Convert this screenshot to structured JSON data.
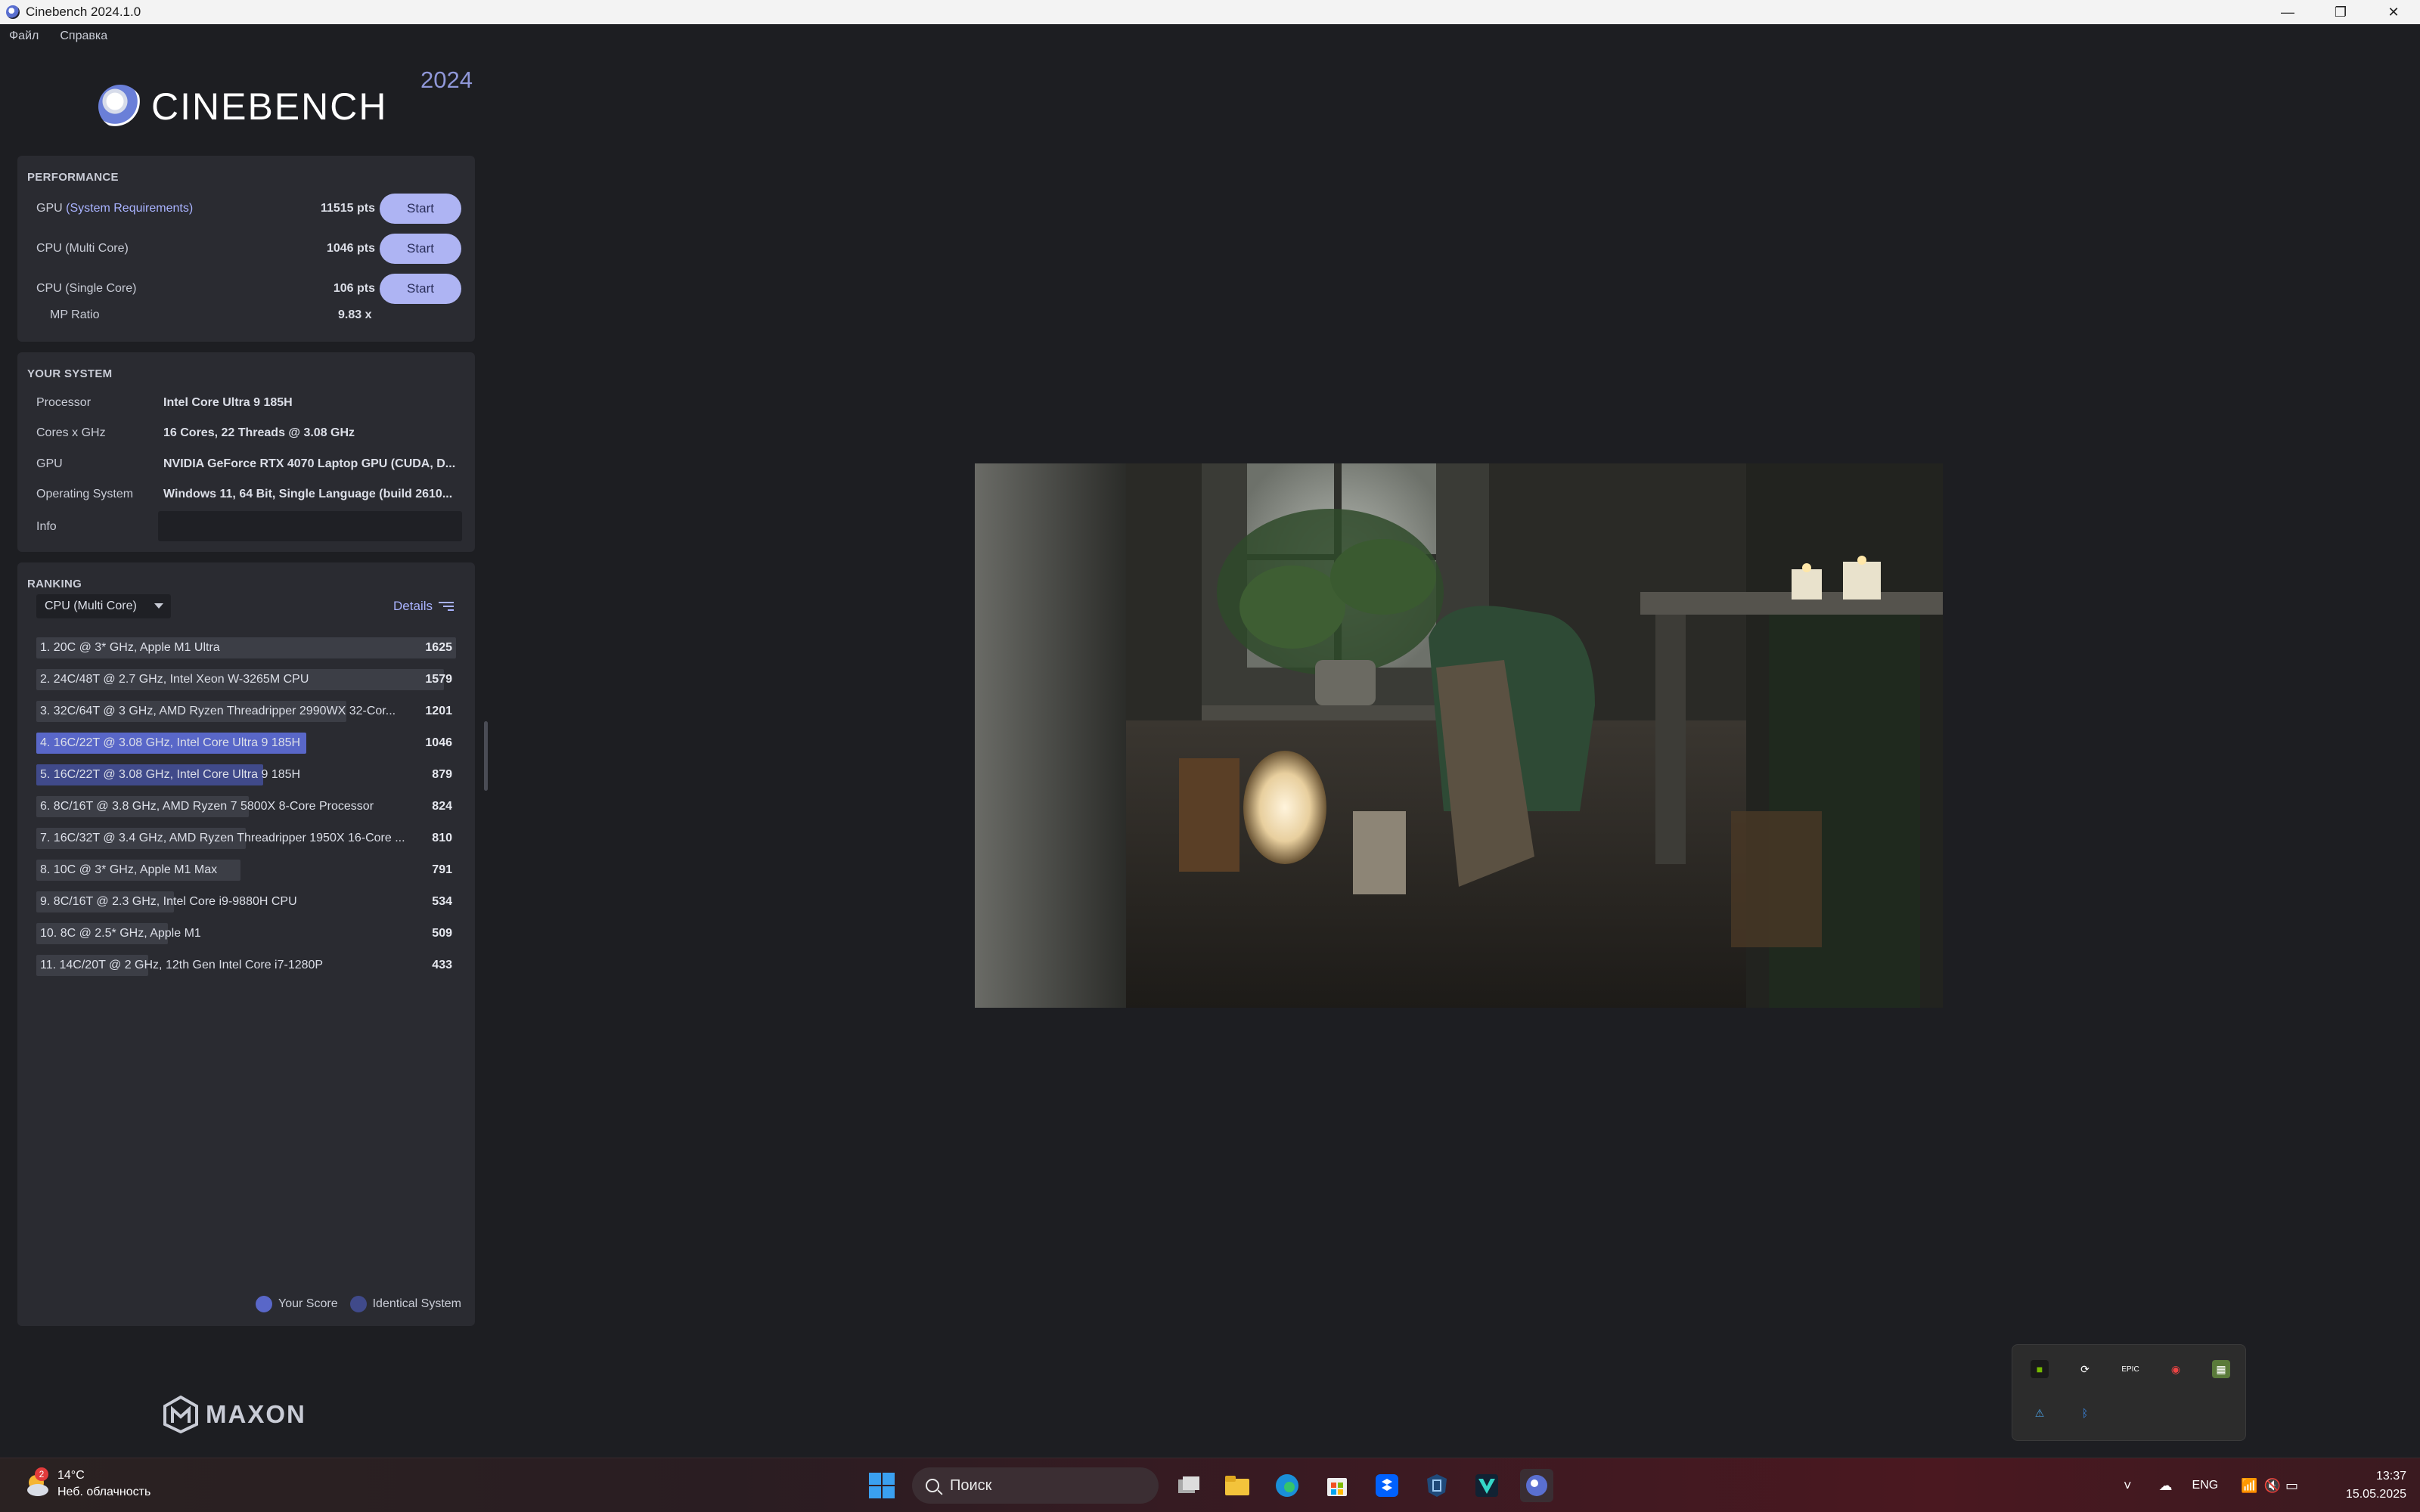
{
  "window": {
    "title": "Cinebench 2024.1.0",
    "minimize": "—",
    "restore": "❐",
    "close": "✕"
  },
  "menu": [
    "Файл",
    "Справка"
  ],
  "logo": {
    "word": "CINEBENCH",
    "year": "2024"
  },
  "performance": {
    "title": "PERFORMANCE",
    "rows": [
      {
        "label": "GPU ",
        "link": "(System Requirements)",
        "pts": "11515 pts",
        "button": "Start"
      },
      {
        "label": "CPU (Multi Core)",
        "link": "",
        "pts": "1046 pts",
        "button": "Start"
      },
      {
        "label": "CPU (Single Core)",
        "link": "",
        "pts": "106 pts",
        "button": "Start"
      }
    ],
    "mp_label": "MP Ratio",
    "mp_value": "9.83 x"
  },
  "system": {
    "title": "YOUR SYSTEM",
    "rows": [
      {
        "k": "Processor",
        "v": "Intel Core Ultra 9 185H"
      },
      {
        "k": "Cores x GHz",
        "v": "16 Cores, 22 Threads @ 3.08 GHz"
      },
      {
        "k": "GPU",
        "v": "NVIDIA GeForce RTX 4070 Laptop GPU (CUDA, D..."
      },
      {
        "k": "Operating System",
        "v": "Windows 11, 64 Bit, Single Language (build 2610..."
      },
      {
        "k": "Info",
        "v": ""
      }
    ]
  },
  "ranking": {
    "title": "RANKING",
    "select": "CPU (Multi Core)",
    "details": "Details",
    "items": [
      {
        "name": "1. 20C @ 3* GHz, Apple M1 Ultra",
        "score": "1625",
        "value": 1625,
        "kind": "other"
      },
      {
        "name": "2. 24C/48T @ 2.7 GHz, Intel Xeon W-3265M CPU",
        "score": "1579",
        "value": 1579,
        "kind": "other"
      },
      {
        "name": "3. 32C/64T @ 3 GHz, AMD Ryzen Threadripper 2990WX 32-Cor...",
        "score": "1201",
        "value": 1201,
        "kind": "other"
      },
      {
        "name": "4. 16C/22T @ 3.08 GHz, Intel Core Ultra 9 185H",
        "score": "1046",
        "value": 1046,
        "kind": "mine"
      },
      {
        "name": "5. 16C/22T @ 3.08 GHz, Intel Core Ultra 9 185H",
        "score": "879",
        "value": 879,
        "kind": "ident"
      },
      {
        "name": "6. 8C/16T @ 3.8 GHz, AMD Ryzen 7 5800X 8-Core Processor",
        "score": "824",
        "value": 824,
        "kind": "other"
      },
      {
        "name": "7. 16C/32T @ 3.4 GHz, AMD Ryzen Threadripper 1950X 16-Core ...",
        "score": "810",
        "value": 810,
        "kind": "other"
      },
      {
        "name": "8. 10C @ 3* GHz, Apple M1 Max",
        "score": "791",
        "value": 791,
        "kind": "other"
      },
      {
        "name": "9. 8C/16T @ 2.3 GHz, Intel Core i9-9880H CPU",
        "score": "534",
        "value": 534,
        "kind": "other"
      },
      {
        "name": "10. 8C @ 2.5* GHz, Apple M1",
        "score": "509",
        "value": 509,
        "kind": "other"
      },
      {
        "name": "11. 14C/20T @ 2 GHz, 12th Gen Intel Core i7-1280P",
        "score": "433",
        "value": 433,
        "kind": "other"
      }
    ],
    "legend": [
      {
        "label": "Your Score",
        "color": "#5967c8"
      },
      {
        "label": "Identical System",
        "color": "#404a8a"
      }
    ]
  },
  "brand": {
    "maxon": "MAXON"
  },
  "taskbar": {
    "weather_temp": "14°C",
    "weather_desc": "Неб. облачность",
    "weather_badge": "2",
    "search_placeholder": "Поиск",
    "lang": "ENG",
    "time": "13:37",
    "date": "15.05.2025"
  },
  "colors": {
    "accent": "#aeb4f3",
    "your_score": "#5967c8",
    "identical": "#404a8a",
    "link": "#a9b3ff"
  }
}
